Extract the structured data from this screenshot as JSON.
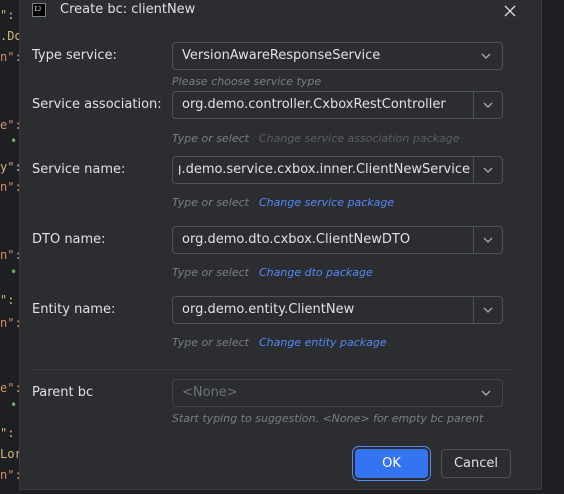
{
  "dialog": {
    "title": "Create bc: clientNew",
    "icon": "intellij-idea-icon"
  },
  "fields": {
    "type_service": {
      "label": "Type service:",
      "value": "VersionAwareResponseService",
      "hint": "Please choose service type"
    },
    "service_association": {
      "label": "Service association:",
      "value": "org.demo.controller.CxboxRestController",
      "hint": "Type or select",
      "link": "Change service association package"
    },
    "service_name": {
      "label": "Service name:",
      "value": "org.demo.service.cxbox.inner.ClientNewService",
      "hint": "Type or select",
      "link": "Change service package"
    },
    "dto_name": {
      "label": "DTO name:",
      "value": "org.demo.dto.cxbox.ClientNewDTO",
      "hint": "Type or select",
      "link": "Change dto package"
    },
    "entity_name": {
      "label": "Entity name:",
      "value": "org.demo.entity.ClientNew",
      "hint": "Type or select",
      "link": "Change entity package"
    },
    "parent_bc": {
      "label": "Parent bc",
      "value": "<None>",
      "hint": "Start typing to suggestion. <None> for empty bc parent"
    }
  },
  "buttons": {
    "ok": "OK",
    "cancel": "Cancel"
  },
  "colors": {
    "dialog_bg": "#2b2d30",
    "accent": "#3574f0",
    "link": "#548af7",
    "hint": "#7a7e85"
  },
  "background_code": {
    "fragments": [
      "\":",
      ".Do",
      "n\":",
      "e\":",
      "•",
      "y\":",
      "n\":",
      "n\":",
      "•",
      "\":",
      "n\":",
      "e\":",
      "•",
      "\":",
      "Lor",
      "n\":"
    ]
  }
}
